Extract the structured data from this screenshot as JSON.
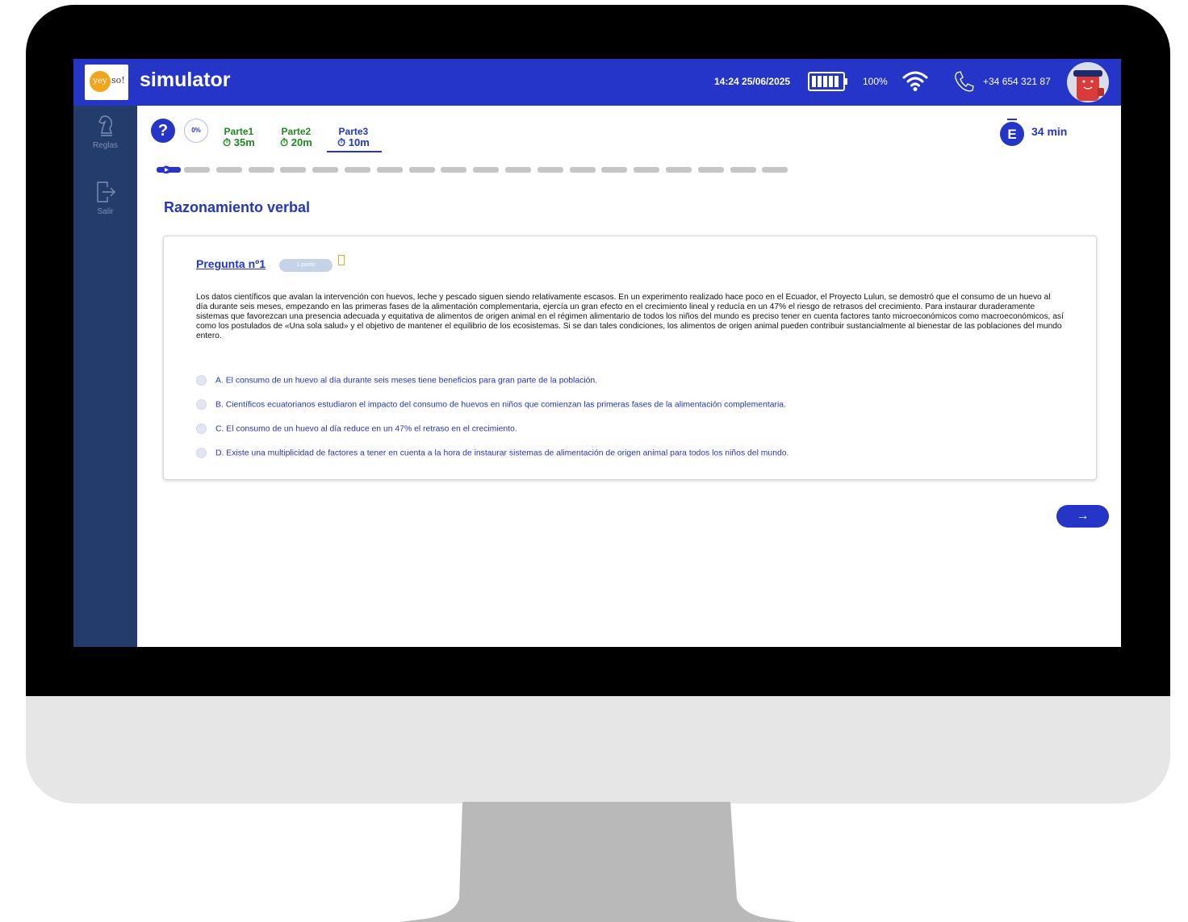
{
  "app": {
    "logo_left": "yey",
    "logo_right": "so!",
    "title": "simulator"
  },
  "status": {
    "datetime": "14:24 25/06/2025",
    "battery_percent": "100%",
    "phone": "+34 654 321 87",
    "battery_icon": "battery-icon",
    "wifi_icon": "wifi-icon",
    "phone_icon": "phone-icon"
  },
  "sidebar": {
    "items": [
      {
        "label": "Reglas",
        "icon": "chess-knight-icon"
      },
      {
        "label": "Salir",
        "icon": "exit-icon"
      }
    ]
  },
  "exam": {
    "help": "?",
    "progress": "0%",
    "parts": [
      {
        "label": "Parte1",
        "time": "⏱ 35m",
        "color": "#1f8a1f"
      },
      {
        "label": "Parte2",
        "time": "⏱ 20m",
        "color": "#1f8a1f"
      },
      {
        "label": "Parte3",
        "time": "⏱ 10m",
        "color": "#2435c8",
        "active": true
      }
    ],
    "exam_badge": "E",
    "remaining": "34 min",
    "question_count": 20,
    "current_question": 1
  },
  "section": {
    "title": "Razonamiento verbal"
  },
  "question": {
    "title": "Pregunta nº1",
    "points": "1 punto",
    "passage": "Los datos científicos que avalan la intervención con huevos, leche y pescado siguen siendo relativamente escasos. En un experimento realizado hace poco en el Ecuador, el Proyecto Lulun, se demostró que el consumo de un huevo al día durante seis meses, empezando en las primeras fases de la alimentación complementaria, ejercía un gran efecto en el crecimiento lineal y reducía en un 47% el riesgo de retrasos del crecimiento. Para instaurar duraderamente sistemas que favorezcan una presencia adecuada y equitativa de alimentos de origen animal en el régimen alimentario de todos los niños del mundo es preciso tener en cuenta factores tanto microeconómicos como macroeconómicos, así como los postulados de «Una sola salud» y el objetivo de mantener el equilibrio de los ecosistemas. Si se dan tales condiciones, los alimentos de origen animal pueden contribuir sustancialmente al bienestar de las poblaciones del mundo entero.",
    "options": [
      "A. El consumo de un huevo al día durante seis meses tiene beneficios para gran parte de la población.",
      "B. Científicos ecuatorianos estudiaron el impacto del consumo de huevos en niños que comienzan las primeras fases de la alimentación complementaria.",
      "C. El consumo de un huevo al día reduce en un 47% el retraso en el crecimiento.",
      "D. Existe una multiplicidad de factores a tener en cuenta a la hora de instaurar sistemas de alimentación de origen animal para todos los niños del mundo."
    ]
  },
  "nav": {
    "next": "→"
  },
  "colors": {
    "primary": "#2435c8",
    "sidebar": "#243c6b",
    "accent": "#f2a51a",
    "green": "#1f8a1f"
  }
}
